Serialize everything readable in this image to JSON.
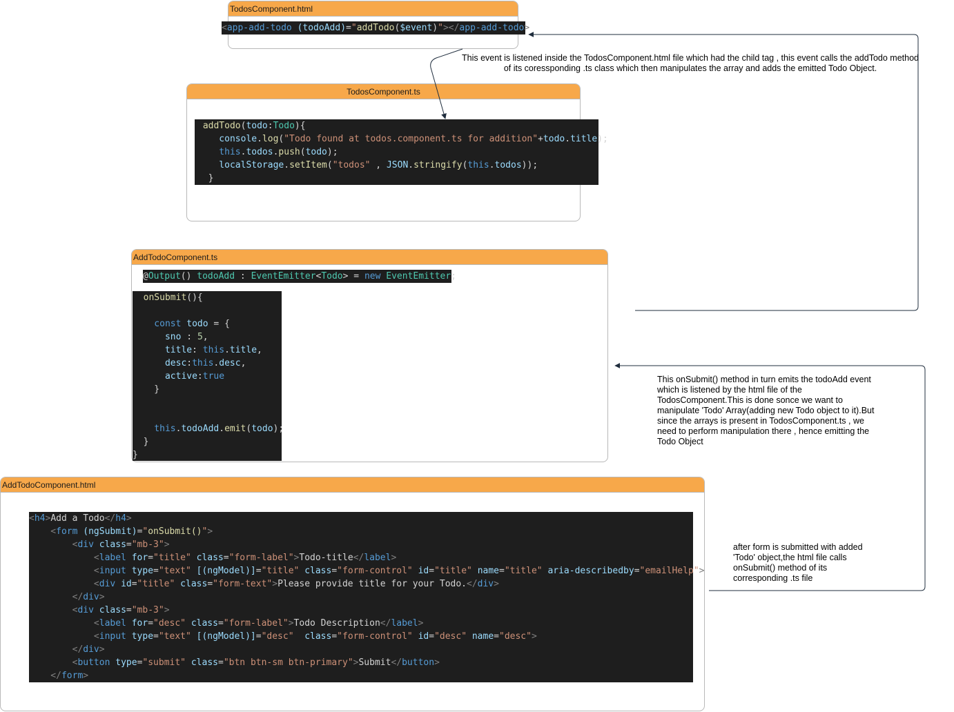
{
  "boxes": {
    "todos_html": {
      "title": "TodosComponent.html"
    },
    "todos_ts": {
      "title": "TodosComponent.ts"
    },
    "addtodo_ts": {
      "title": "AddTodoComponent.ts"
    },
    "addtodo_html": {
      "title": "AddTodoComponent.html"
    }
  },
  "code": {
    "todos_html": [
      [
        [
          "<",
          "tg"
        ],
        [
          "app-add-todo",
          "tn"
        ],
        [
          " ",
          "tx"
        ],
        [
          "(todoAdd)",
          "at"
        ],
        [
          "=",
          "tx"
        ],
        [
          "\"",
          "st"
        ],
        [
          "addTodo",
          "fn"
        ],
        [
          "(",
          "tx"
        ],
        [
          "$event",
          "at"
        ],
        [
          ")",
          "tx"
        ],
        [
          "\"",
          "st"
        ],
        [
          "></",
          "tg"
        ],
        [
          "app-add-todo",
          "tn"
        ],
        [
          ">",
          "tg"
        ]
      ]
    ],
    "todos_ts": [
      [
        [
          " addTodo",
          "fn"
        ],
        [
          "(",
          "tx"
        ],
        [
          "todo",
          "at"
        ],
        [
          ":",
          "tx"
        ],
        [
          "Todo",
          "ty"
        ],
        [
          "){",
          "tx"
        ]
      ],
      [
        [
          "    console",
          "at"
        ],
        [
          ".",
          "tx"
        ],
        [
          "log",
          "fn"
        ],
        [
          "(",
          "tx"
        ],
        [
          "\"Todo found at todos.component.ts for addition\"",
          "st"
        ],
        [
          "+",
          "tx"
        ],
        [
          "todo",
          "at"
        ],
        [
          ".",
          "tx"
        ],
        [
          "title",
          "at"
        ],
        [
          ");",
          "tx"
        ]
      ],
      [
        [
          "    this",
          "tn"
        ],
        [
          ".",
          "tx"
        ],
        [
          "todos",
          "at"
        ],
        [
          ".",
          "tx"
        ],
        [
          "push",
          "fn"
        ],
        [
          "(",
          "tx"
        ],
        [
          "todo",
          "at"
        ],
        [
          ");",
          "tx"
        ]
      ],
      [
        [
          "    localStorage",
          "at"
        ],
        [
          ".",
          "tx"
        ],
        [
          "setItem",
          "fn"
        ],
        [
          "(",
          "tx"
        ],
        [
          "\"todos\"",
          "st"
        ],
        [
          " , ",
          "tx"
        ],
        [
          "JSON",
          "at"
        ],
        [
          ".",
          "tx"
        ],
        [
          "stringify",
          "fn"
        ],
        [
          "(",
          "tx"
        ],
        [
          "this",
          "tn"
        ],
        [
          ".",
          "tx"
        ],
        [
          "todos",
          "at"
        ],
        [
          "));",
          "tx"
        ]
      ],
      [
        [
          "  }",
          "tx"
        ]
      ]
    ],
    "addtodo_ts_output": [
      [
        [
          "@",
          "tx"
        ],
        [
          "Output",
          "ty"
        ],
        [
          "() ",
          "tx"
        ],
        [
          "todoAdd",
          "ty"
        ],
        [
          " : ",
          "tx"
        ],
        [
          "EventEmitter",
          "ty"
        ],
        [
          "<",
          "tx"
        ],
        [
          "Todo",
          "ty"
        ],
        [
          "> = ",
          "tx"
        ],
        [
          "new",
          "tn"
        ],
        [
          " ",
          "tx"
        ],
        [
          "EventEmitter",
          "ty"
        ],
        [
          ";",
          "tx"
        ]
      ]
    ],
    "addtodo_ts_submit": [
      [
        [
          "  onSubmit",
          "fn"
        ],
        [
          "(){",
          "tx"
        ]
      ],
      [
        [
          "",
          "tx"
        ]
      ],
      [
        [
          "    const",
          "tn"
        ],
        [
          " ",
          "tx"
        ],
        [
          "todo",
          "at"
        ],
        [
          " = {",
          "tx"
        ]
      ],
      [
        [
          "      sno",
          "at"
        ],
        [
          " : ",
          "tx"
        ],
        [
          "5",
          "nm"
        ],
        [
          ",",
          "tx"
        ]
      ],
      [
        [
          "      title",
          "at"
        ],
        [
          ": ",
          "tx"
        ],
        [
          "this",
          "tn"
        ],
        [
          ".",
          "tx"
        ],
        [
          "title",
          "at"
        ],
        [
          ",",
          "tx"
        ]
      ],
      [
        [
          "      desc",
          "at"
        ],
        [
          ":",
          "tx"
        ],
        [
          "this",
          "tn"
        ],
        [
          ".",
          "tx"
        ],
        [
          "desc",
          "at"
        ],
        [
          ",",
          "tx"
        ]
      ],
      [
        [
          "      active",
          "at"
        ],
        [
          ":",
          "tx"
        ],
        [
          "true",
          "tn"
        ]
      ],
      [
        [
          "    }",
          "tx"
        ]
      ],
      [
        [
          "",
          "tx"
        ]
      ],
      [
        [
          "",
          "tx"
        ]
      ],
      [
        [
          "    this",
          "tn"
        ],
        [
          ".",
          "tx"
        ],
        [
          "todoAdd",
          "at"
        ],
        [
          ".",
          "tx"
        ],
        [
          "emit",
          "fn"
        ],
        [
          "(",
          "tx"
        ],
        [
          "todo",
          "at"
        ],
        [
          ");",
          "tx"
        ]
      ],
      [
        [
          "  }",
          "tx"
        ]
      ],
      [
        [
          "}",
          "tx"
        ]
      ]
    ],
    "addtodo_html": [
      [
        [
          "<",
          "tg"
        ],
        [
          "h4",
          "tn"
        ],
        [
          ">",
          "tg"
        ],
        [
          "Add a Todo",
          "tx"
        ],
        [
          "</",
          "tg"
        ],
        [
          "h4",
          "tn"
        ],
        [
          ">",
          "tg"
        ]
      ],
      [
        [
          "    <",
          "tg"
        ],
        [
          "form",
          "tn"
        ],
        [
          " ",
          "tx"
        ],
        [
          "(ngSubmit)",
          "at"
        ],
        [
          "=",
          "tx"
        ],
        [
          "\"",
          "st"
        ],
        [
          "onSubmit()",
          "fn"
        ],
        [
          "\"",
          "st"
        ],
        [
          ">",
          "tg"
        ]
      ],
      [
        [
          "        <",
          "tg"
        ],
        [
          "div",
          "tn"
        ],
        [
          " ",
          "tx"
        ],
        [
          "class",
          "at"
        ],
        [
          "=",
          "tx"
        ],
        [
          "\"mb-3\"",
          "st"
        ],
        [
          ">",
          "tg"
        ]
      ],
      [
        [
          "            <",
          "tg"
        ],
        [
          "label",
          "tn"
        ],
        [
          " ",
          "tx"
        ],
        [
          "for",
          "at"
        ],
        [
          "=",
          "tx"
        ],
        [
          "\"title\"",
          "st"
        ],
        [
          " ",
          "tx"
        ],
        [
          "class",
          "at"
        ],
        [
          "=",
          "tx"
        ],
        [
          "\"form-label\"",
          "st"
        ],
        [
          ">",
          "tg"
        ],
        [
          "Todo-title",
          "tx"
        ],
        [
          "</",
          "tg"
        ],
        [
          "label",
          "tn"
        ],
        [
          ">",
          "tg"
        ]
      ],
      [
        [
          "            <",
          "tg"
        ],
        [
          "input",
          "tn"
        ],
        [
          " ",
          "tx"
        ],
        [
          "type",
          "at"
        ],
        [
          "=",
          "tx"
        ],
        [
          "\"text\"",
          "st"
        ],
        [
          " ",
          "tx"
        ],
        [
          "[(ngModel)]",
          "at"
        ],
        [
          "=",
          "tx"
        ],
        [
          "\"title\"",
          "st"
        ],
        [
          " ",
          "tx"
        ],
        [
          "class",
          "at"
        ],
        [
          "=",
          "tx"
        ],
        [
          "\"form-control\"",
          "st"
        ],
        [
          " ",
          "tx"
        ],
        [
          "id",
          "at"
        ],
        [
          "=",
          "tx"
        ],
        [
          "\"title\"",
          "st"
        ],
        [
          " ",
          "tx"
        ],
        [
          "name",
          "at"
        ],
        [
          "=",
          "tx"
        ],
        [
          "\"title\"",
          "st"
        ],
        [
          " ",
          "tx"
        ],
        [
          "aria-describedby",
          "at"
        ],
        [
          "=",
          "tx"
        ],
        [
          "\"emailHelp\"",
          "st"
        ],
        [
          ">",
          "tg"
        ]
      ],
      [
        [
          "            <",
          "tg"
        ],
        [
          "div",
          "tn"
        ],
        [
          " ",
          "tx"
        ],
        [
          "id",
          "at"
        ],
        [
          "=",
          "tx"
        ],
        [
          "\"title\"",
          "st"
        ],
        [
          " ",
          "tx"
        ],
        [
          "class",
          "at"
        ],
        [
          "=",
          "tx"
        ],
        [
          "\"form-text\"",
          "st"
        ],
        [
          ">",
          "tg"
        ],
        [
          "Please provide title for your Todo.",
          "tx"
        ],
        [
          "</",
          "tg"
        ],
        [
          "div",
          "tn"
        ],
        [
          ">",
          "tg"
        ]
      ],
      [
        [
          "        </",
          "tg"
        ],
        [
          "div",
          "tn"
        ],
        [
          ">",
          "tg"
        ]
      ],
      [
        [
          "        <",
          "tg"
        ],
        [
          "div",
          "tn"
        ],
        [
          " ",
          "tx"
        ],
        [
          "class",
          "at"
        ],
        [
          "=",
          "tx"
        ],
        [
          "\"mb-3\"",
          "st"
        ],
        [
          ">",
          "tg"
        ]
      ],
      [
        [
          "            <",
          "tg"
        ],
        [
          "label",
          "tn"
        ],
        [
          " ",
          "tx"
        ],
        [
          "for",
          "at"
        ],
        [
          "=",
          "tx"
        ],
        [
          "\"desc\"",
          "st"
        ],
        [
          " ",
          "tx"
        ],
        [
          "class",
          "at"
        ],
        [
          "=",
          "tx"
        ],
        [
          "\"form-label\"",
          "st"
        ],
        [
          ">",
          "tg"
        ],
        [
          "Todo Description",
          "tx"
        ],
        [
          "</",
          "tg"
        ],
        [
          "label",
          "tn"
        ],
        [
          ">",
          "tg"
        ]
      ],
      [
        [
          "            <",
          "tg"
        ],
        [
          "input",
          "tn"
        ],
        [
          " ",
          "tx"
        ],
        [
          "type",
          "at"
        ],
        [
          "=",
          "tx"
        ],
        [
          "\"text\"",
          "st"
        ],
        [
          " ",
          "tx"
        ],
        [
          "[(ngModel)]",
          "at"
        ],
        [
          "=",
          "tx"
        ],
        [
          "\"desc\"",
          "st"
        ],
        [
          "  ",
          "tx"
        ],
        [
          "class",
          "at"
        ],
        [
          "=",
          "tx"
        ],
        [
          "\"form-control\"",
          "st"
        ],
        [
          " ",
          "tx"
        ],
        [
          "id",
          "at"
        ],
        [
          "=",
          "tx"
        ],
        [
          "\"desc\"",
          "st"
        ],
        [
          " ",
          "tx"
        ],
        [
          "name",
          "at"
        ],
        [
          "=",
          "tx"
        ],
        [
          "\"desc\"",
          "st"
        ],
        [
          ">",
          "tg"
        ]
      ],
      [
        [
          "        </",
          "tg"
        ],
        [
          "div",
          "tn"
        ],
        [
          ">",
          "tg"
        ]
      ],
      [
        [
          "        <",
          "tg"
        ],
        [
          "button",
          "tn"
        ],
        [
          " ",
          "tx"
        ],
        [
          "type",
          "at"
        ],
        [
          "=",
          "tx"
        ],
        [
          "\"submit\"",
          "st"
        ],
        [
          " ",
          "tx"
        ],
        [
          "class",
          "at"
        ],
        [
          "=",
          "tx"
        ],
        [
          "\"btn btn-sm btn-primary\"",
          "st"
        ],
        [
          ">",
          "tg"
        ],
        [
          "Submit",
          "tx"
        ],
        [
          "</",
          "tg"
        ],
        [
          "button",
          "tn"
        ],
        [
          ">",
          "tg"
        ]
      ],
      [
        [
          "    </",
          "tg"
        ],
        [
          "form",
          "tn"
        ],
        [
          ">",
          "tg"
        ]
      ]
    ]
  },
  "notes": {
    "event_listened": [
      "This event is listened inside the TodosComponent.html file which had the child tag , this event calls the addTodo method",
      "of its coressponding .ts class which then manipulates the array and adds the emitted Todo Object."
    ],
    "onsubmit_emits": [
      "This onSubmit() method in turn emits the todoAdd event",
      "which is listened by the html file of the",
      "TodosComponent.This is done sonce we want to",
      "manipulate 'Todo' Array(adding new Todo object to it).But",
      "since the arrays is present in TodosComponent.ts , we",
      "need to perform manipulation there , hence emitting the",
      "Todo Object"
    ],
    "form_submitted": [
      "after form is submitted with added",
      "'Todo' object,the html file calls",
      "onSubmit() method of its",
      "corresponding .ts file"
    ]
  },
  "colors": {
    "header": "#f7a84a",
    "code_bg": "#1e1e1e",
    "border": "#b8b8b8",
    "arrow": "#1f2d3d"
  }
}
